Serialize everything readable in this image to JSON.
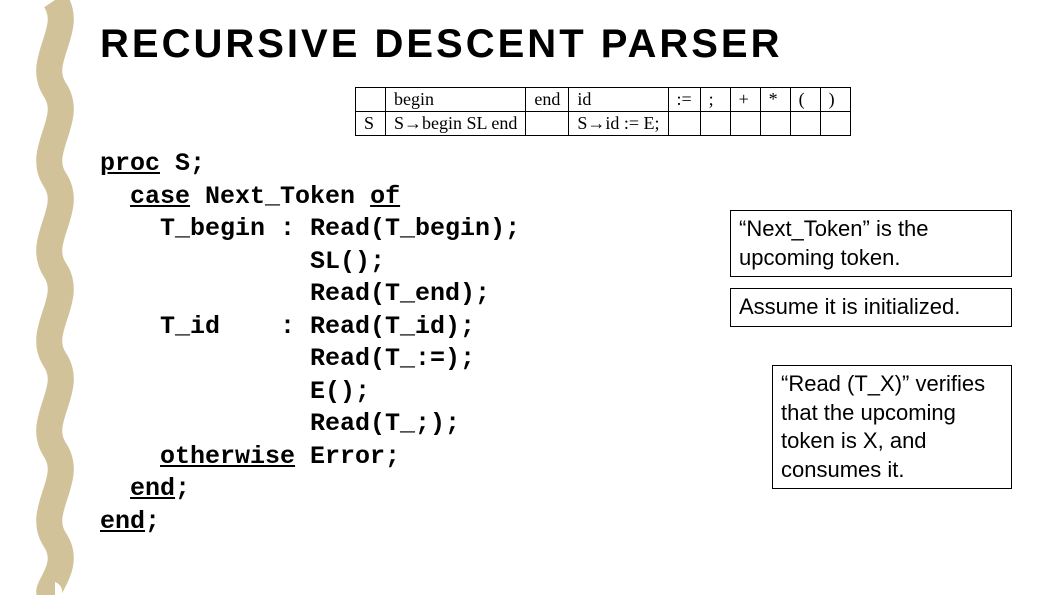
{
  "title": "RECURSIVE DESCENT PARSER",
  "grammar_table": {
    "headers": [
      "",
      "begin",
      "end",
      "id",
      ":=",
      ";",
      "+",
      "*",
      "(",
      ")"
    ],
    "rows": [
      {
        "cells": [
          "S",
          "S→begin SL end",
          "",
          "S→id := E;",
          "",
          "",
          "",
          "",
          "",
          ""
        ]
      }
    ]
  },
  "code": {
    "l1a": "proc",
    "l1b": " S;",
    "l2a": "  ",
    "l2b": "case",
    "l2c": " Next_Token ",
    "l2d": "of",
    "l3": "    T_begin : Read(T_begin);",
    "l4": "              SL();",
    "l5": "              Read(T_end);",
    "l6": "    T_id    : Read(T_id);",
    "l7": "              Read(T_:=);",
    "l8": "              E();",
    "l9": "              Read(T_;);",
    "l10a": "    ",
    "l10b": "otherwise",
    "l10c": " Error;",
    "l11a": "  ",
    "l11b": "end",
    "l11c": ";",
    "l12a": "",
    "l12b": "end",
    "l12c": ";"
  },
  "notes": {
    "n1": "“Next_Token” is the upcoming token.",
    "n2": "Assume it is initialized.",
    "n3": "“Read (T_X)” verifies that the upcoming token is X, and consumes it."
  }
}
